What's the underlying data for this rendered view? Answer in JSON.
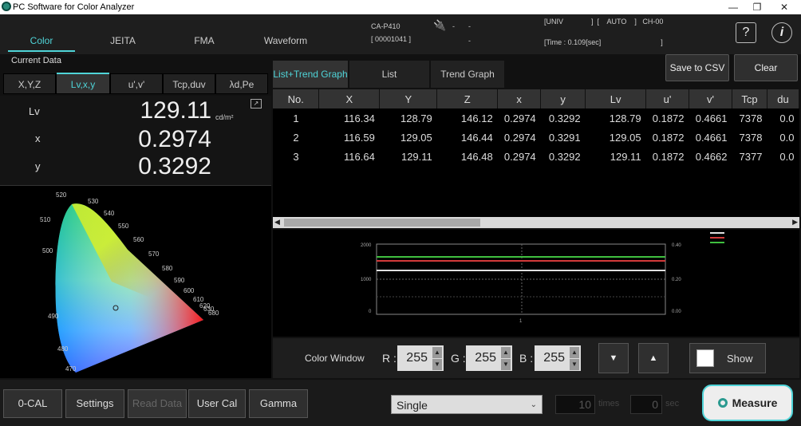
{
  "window": {
    "title": "PC Software for Color Analyzer",
    "min": "—",
    "max": "❐",
    "close": "✕"
  },
  "header": {
    "tabs": [
      {
        "label": "Color"
      },
      {
        "label": "JEITA"
      },
      {
        "label": "FMA"
      },
      {
        "label": "Waveform"
      }
    ],
    "device_model": "CA-P410",
    "device_serial": "[ 00001041 ]",
    "probe_dash1": "-",
    "probe_dash2": "-",
    "probe_dash3": "-",
    "status_line1": "[UNIV              ]  [    AUTO    ]   CH-00",
    "status_line2": "[Time : 0.109[sec]                              ]",
    "help_icon": "?",
    "info_icon": "i"
  },
  "left": {
    "section_label": "Current Data",
    "tabs": [
      {
        "label": "X,Y,Z"
      },
      {
        "label": "Lv,x,y"
      },
      {
        "label": "u',v'"
      },
      {
        "label": "Tcp,duv"
      },
      {
        "label": "λd,Pe"
      }
    ],
    "readings": [
      {
        "label": "Lv",
        "value": "129.11",
        "unit": "cd/m²"
      },
      {
        "label": "x",
        "value": "0.2974",
        "unit": ""
      },
      {
        "label": "y",
        "value": "0.3292",
        "unit": ""
      }
    ],
    "wavelength_labels": [
      "520",
      "530",
      "540",
      "550",
      "560",
      "570",
      "580",
      "590",
      "600",
      "610",
      "620",
      "630",
      "680",
      "510",
      "500",
      "490",
      "480",
      "470"
    ]
  },
  "right": {
    "tabs": [
      {
        "label": "List+Trend Graph"
      },
      {
        "label": "List"
      },
      {
        "label": "Trend Graph"
      }
    ],
    "save_csv": "Save to CSV",
    "clear": "Clear",
    "columns": [
      "No.",
      "X",
      "Y",
      "Z",
      "x",
      "y",
      "Lv",
      "u'",
      "v'",
      "Tcp",
      "du"
    ],
    "rows": [
      [
        "1",
        "116.34",
        "128.79",
        "146.12",
        "0.2974",
        "0.3292",
        "128.79",
        "0.1872",
        "0.4661",
        "7378",
        "0.0"
      ],
      [
        "2",
        "116.59",
        "129.05",
        "146.44",
        "0.2974",
        "0.3291",
        "129.05",
        "0.1872",
        "0.4661",
        "7378",
        "0.0"
      ],
      [
        "3",
        "116.64",
        "129.11",
        "146.48",
        "0.2974",
        "0.3292",
        "129.11",
        "0.1872",
        "0.4662",
        "7377",
        "0.0"
      ]
    ]
  },
  "trend": {
    "y_left_ticks": [
      "2000",
      "1000",
      "0"
    ],
    "y_right_ticks": [
      "0.40",
      "0.20",
      "0.00"
    ],
    "x_tick": "1"
  },
  "color_window": {
    "label": "Color Window",
    "r_label": "R :",
    "g_label": "G :",
    "b_label": "B :",
    "r": "255",
    "g": "255",
    "b": "255",
    "down": "▼",
    "up": "▲",
    "show": "Show"
  },
  "bottom": {
    "zero_cal": "0-CAL",
    "settings": "Settings",
    "read_data": "Read Data",
    "user_cal": "User Cal",
    "gamma": "Gamma",
    "mode": "Single",
    "times_value": "10",
    "times_unit": "times",
    "sec_value": "0",
    "sec_unit": "sec",
    "measure": "Measure"
  },
  "colors": {
    "accent": "#4fd4d8",
    "trend_green": "#3fbf3f",
    "trend_red": "#d23a3a",
    "trend_white": "#e0e0e0"
  }
}
